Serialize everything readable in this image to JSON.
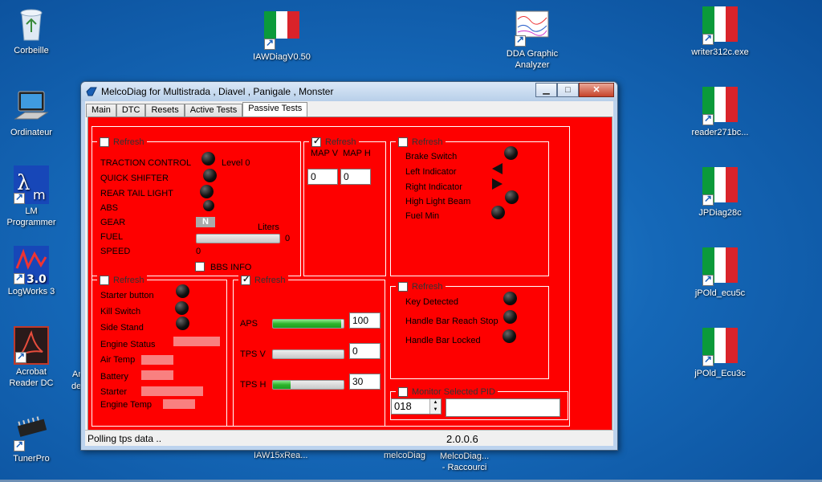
{
  "desktop": {
    "icons": [
      {
        "label": "Corbeille"
      },
      {
        "label": "Ordinateur"
      },
      {
        "label": "LM\nProgrammer"
      },
      {
        "label": "LogWorks 3"
      },
      {
        "label": "Acrobat\nReader DC"
      },
      {
        "label": "TunerPro"
      },
      {
        "label": "IAWDiagV0.50"
      },
      {
        "label": "DDA Graphic\nAnalyzer"
      },
      {
        "label": "writer312c.exe"
      },
      {
        "label": "reader271bc..."
      },
      {
        "label": "JPDiag28c"
      },
      {
        "label": "jPOld_ecu5c"
      },
      {
        "label": "jPOld_Ecu3c"
      },
      {
        "label": "IAW15xRea..."
      },
      {
        "label": "melcoDiag"
      },
      {
        "label": "MelcoDiag...\n- Raccourci"
      },
      {
        "label": "Ar"
      },
      {
        "label": "de"
      }
    ]
  },
  "window": {
    "title": "MelcoDiag for Multistrada , Diavel , Panigale , Monster",
    "buttons": {
      "minimize": "▁",
      "maximize": "□",
      "close": "✕"
    },
    "tabs": [
      {
        "label": "Main"
      },
      {
        "label": "DTC"
      },
      {
        "label": "Resets"
      },
      {
        "label": "Active Tests"
      },
      {
        "label": "Passive Tests"
      }
    ],
    "active_tab": "Passive Tests"
  },
  "panels": {
    "status1": {
      "refresh": "Refresh",
      "traction_control": "TRACTION CONTROL",
      "level": "Level 0",
      "quick_shifter": "QUICK SHIFTER",
      "rear_tail_light": "REAR TAIL LIGHT",
      "abs": "ABS",
      "gear": "GEAR",
      "gear_value": "N",
      "fuel": "FUEL",
      "liters": "Liters",
      "fuel_value": "0",
      "fuel_level": 0,
      "speed": "SPEED",
      "speed_value": "0",
      "bbs_info": "BBS INFO"
    },
    "map": {
      "refresh": "Refresh",
      "refresh_checked": true,
      "labels": "MAP V  MAP H",
      "map_v": "0",
      "map_h": "0"
    },
    "lights": {
      "refresh": "Refresh",
      "brake_switch": "Brake Switch",
      "left_indicator": "Left Indicator",
      "right_indicator": "Right Indicator",
      "high_light_beam": "High Light Beam",
      "fuel_min": "Fuel Min"
    },
    "engine": {
      "refresh": "Refresh",
      "starter_button": "Starter button",
      "kill_switch": "Kill Switch",
      "side_stand": "Side Stand",
      "engine_status": "Engine Status",
      "air_temp": "Air Temp",
      "battery": "Battery",
      "starter": "Starter",
      "engine_temp": "Engine Temp"
    },
    "throttle": {
      "refresh": "Refresh",
      "refresh_checked": true,
      "aps": "APS",
      "aps_value": "100",
      "aps_level": 0.97,
      "tps_v": "TPS V",
      "tps_v_value": "0",
      "tps_v_level": 0,
      "tps_h": "TPS H",
      "tps_h_value": "30",
      "tps_h_level": 0.25
    },
    "keys": {
      "refresh": "Refresh",
      "key_detected": "Key Detected",
      "reach_stop": "Handle Bar Reach Stop",
      "bar_locked": "Handle Bar Locked"
    },
    "monitor": {
      "label": "Monitor Selected PID",
      "pid": "018",
      "result": ""
    }
  },
  "statusbar": {
    "message": "Polling tps data ..",
    "version": "2.0.0.6"
  },
  "colors": {
    "panel": "#fe0000",
    "desktop": "#1568b8"
  }
}
